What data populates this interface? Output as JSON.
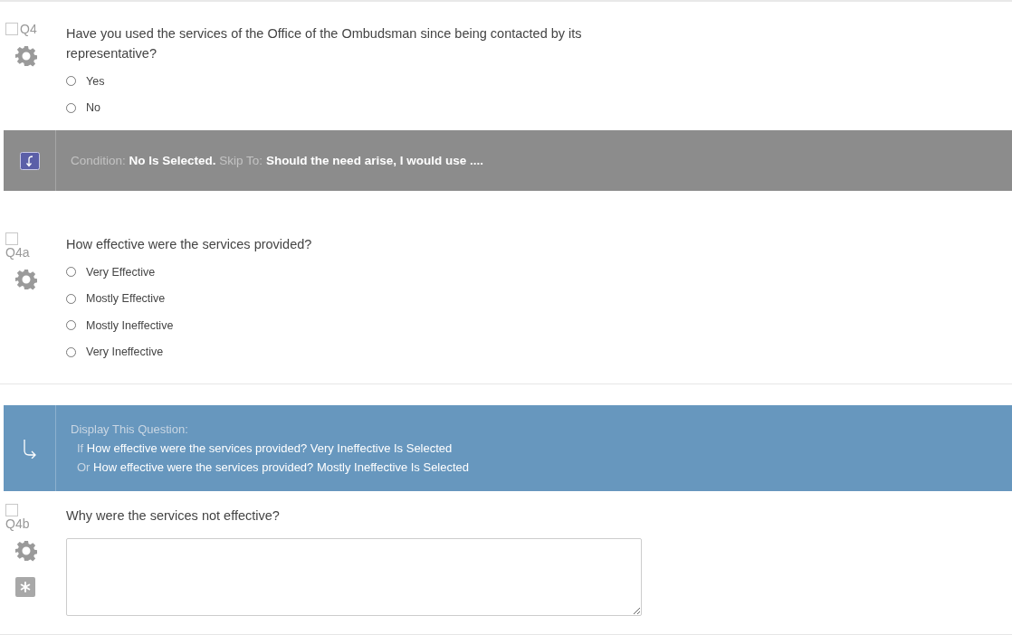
{
  "blocks": [
    {
      "kind": "question",
      "number": "Q4",
      "checked": false,
      "required": false,
      "text": "Have you used the services of the Office of the Ombudsman since being contacted  by its representative?",
      "answer": {
        "kind": "choices",
        "choices": [
          {
            "label": "Yes",
            "selected": false
          },
          {
            "label": "No",
            "selected": false
          }
        ]
      }
    },
    {
      "kind": "skip",
      "condition_label": "Condition:",
      "condition": "No Is Selected.",
      "skip_label": "Skip To:",
      "target": "Should the need arise, I  would use ...."
    },
    {
      "kind": "question",
      "number": "Q4a",
      "checked": false,
      "required": false,
      "text": "How effective were the services provided?",
      "answer": {
        "kind": "choices",
        "choices": [
          {
            "label": "Very Effective",
            "selected": false
          },
          {
            "label": "Mostly Effective",
            "selected": false
          },
          {
            "label": "Mostly Ineffective",
            "selected": false
          },
          {
            "label": "Very Ineffective",
            "selected": false
          }
        ]
      }
    },
    {
      "kind": "display",
      "title": "Display This Question:",
      "conditions": [
        {
          "joiner": "If",
          "text": "How effective were the services provided? Very Ineffective Is Selected"
        },
        {
          "joiner": "Or",
          "text": "How effective were the services provided? Mostly Ineffective Is Selected"
        }
      ]
    },
    {
      "kind": "question",
      "number": "Q4b",
      "checked": false,
      "required": true,
      "text": "Why were the services not effective?",
      "answer": {
        "kind": "text"
      }
    }
  ]
}
